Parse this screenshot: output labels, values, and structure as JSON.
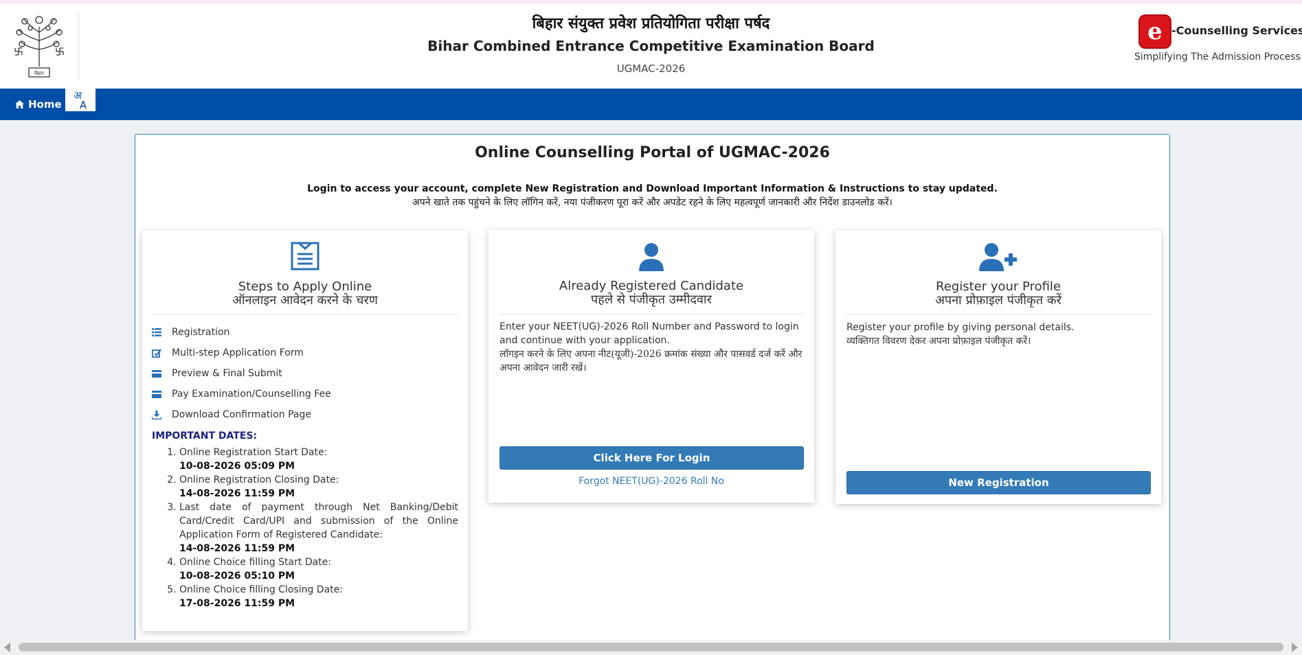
{
  "header": {
    "title_hindi": "बिहार संयुक्त प्रवेश प्रतियोगिता परीक्षा पर्षद",
    "title_english": "Bihar Combined Entrance Competitive Examination Board",
    "exam_code": "UGMAC-2026",
    "logo_text": "e",
    "brand_name": "-Counselling Services",
    "brand_tagline": "Simplifying The Admission Process"
  },
  "nav": {
    "home_label": "Home",
    "lang_hindi": "अ",
    "lang_english": "A"
  },
  "portal": {
    "title": "Online Counselling Portal of UGMAC-2026",
    "subtitle_en": "Login to access your account, complete New Registration and Download Important Information & Instructions to stay updated.",
    "subtitle_hi": "अपने खाते तक पहुंचने के लिए लॉगिन करें, नया पंजीकरण पूरा करें और अपडेट रहने के लिए महत्वपूर्ण जानकारी और निर्देश डाउनलोड करें।"
  },
  "steps_card": {
    "title_en": "Steps to Apply Online",
    "title_hi": "ऑनलाइन आवेदन करने के चरण",
    "steps": [
      {
        "label": "Registration",
        "icon": "list-icon"
      },
      {
        "label": "Multi-step Application Form",
        "icon": "edit-icon"
      },
      {
        "label": "Preview & Final Submit",
        "icon": "card-icon"
      },
      {
        "label": "Pay Examination/Counselling Fee",
        "icon": "credit-card-icon"
      },
      {
        "label": "Download Confirmation Page",
        "icon": "download-icon"
      }
    ],
    "dates_heading": "IMPORTANT DATES:",
    "dates": [
      {
        "label": "Online Registration Start Date:",
        "value": "10-08-2026 05:09 PM"
      },
      {
        "label": "Online Registration Closing Date:",
        "value": "14-08-2026 11:59 PM"
      },
      {
        "label": "Last date of payment through Net Banking/Debit Card/Credit Card/UPI and submission of the Online Application Form of Registered Candidate:",
        "value": "14-08-2026 11:59 PM"
      },
      {
        "label": "Online Choice filling Start Date:",
        "value": "10-08-2026 05:10 PM"
      },
      {
        "label": "Online Choice filling Closing Date:",
        "value": "17-08-2026 11:59 PM"
      }
    ]
  },
  "login_card": {
    "title_en": "Already Registered Candidate",
    "title_hi": "पहले से पंजीकृत उम्मीदवार",
    "text_en": "Enter your NEET(UG)-2026 Roll Number and Password to login and continue with your application.",
    "text_hi": "लॉगइन करने के लिए अपना नीट(यूजी)-2026 क्रमांक संख्या और पासवर्ड दर्ज करें और अपना आवेदन जारी रखें।",
    "button_label": "Click Here For Login",
    "forgot_label": "Forgot NEET(UG)-2026 Roll No"
  },
  "register_card": {
    "title_en": "Register your Profile",
    "title_hi": "अपना प्रोफ़ाइल पंजीकृत करें",
    "text_en": "Register your profile by giving personal details.",
    "text_hi": "व्यक्तिगत विवरण देकर अपना प्रोफ़ाइल पंजीकृत करें।",
    "button_label": "New Registration"
  },
  "colors": {
    "nav_blue": "#004ea8",
    "button_blue": "#337ab7",
    "brand_red": "#d9151b",
    "dates_heading": "#1a237e"
  }
}
